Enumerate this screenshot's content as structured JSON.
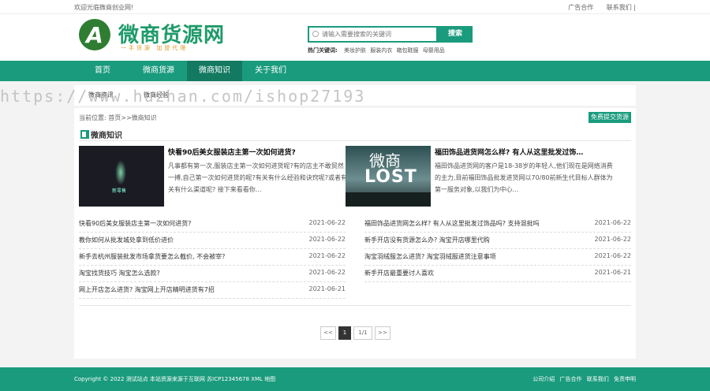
{
  "topbar": {
    "welcome": "欢迎光临微商创业网!",
    "links": [
      "广告合作",
      "联系我们 |"
    ]
  },
  "logo": {
    "letter": "A",
    "title": "微商货源网",
    "slogan": "一手货源 加盟代理"
  },
  "search": {
    "placeholder": "请输入需要搜索的关键词",
    "button": "搜索"
  },
  "hotwords": {
    "label": "热门关键词:",
    "words": [
      "美妆护肤",
      "服装内衣",
      "箱包鞋服",
      "母婴用品"
    ]
  },
  "nav": [
    {
      "label": "首页"
    },
    {
      "label": "微商货源"
    },
    {
      "label": "微商知识"
    },
    {
      "label": "关于我们"
    }
  ],
  "subnav": [
    "微商资讯",
    "微商经验"
  ],
  "watermark": "https://www.huzhan.com/ishop27193",
  "main": {
    "location": "当前位置: 首页>>微商知识",
    "submit_button": "免费提交货源",
    "section_title": "微商知识",
    "features": [
      {
        "title": "快看90后美女服装店主第一次如何进货?",
        "desc": "凡事都有第一次,服装店主第一次如何进货呢?有的店主不敢贸然一搏,自己第一次如何进货的呢?有关有什么经验和诀窍呢?或者有关有什么渠道呢? 接下来看看你…",
        "thumb_text": "新零售"
      },
      {
        "title": "福田饰品进货网怎么样? 有人从这里批发过饰…",
        "desc": "福田饰品进货网的客户是18-38岁的年轻人,他们现在是网络消费的主力,目前福田饰品批发进货网以70/80前新生代目标人群体为第一服务对象,以我们为中心…",
        "thumb_cn": "微商",
        "thumb_en": "LOST"
      }
    ],
    "list_left": [
      {
        "title": "快看90后美女服装店主第一次如何进货?",
        "date": "2021-06-22"
      },
      {
        "title": "教你如何从批发城处拿到低价进价",
        "date": "2021-06-22"
      },
      {
        "title": "新手去杭州服装批发市场拿货要怎么截价, 不会被宰?",
        "date": "2021-06-22"
      },
      {
        "title": "淘宝找货技巧 淘宝怎么选款?",
        "date": "2021-06-22"
      },
      {
        "title": "网上开店怎么进货? 淘宝网上开店精明进货有7招",
        "date": "2021-06-21"
      }
    ],
    "list_right": [
      {
        "title": "福田饰品进货网怎么样? 有人从这里批发过饰品吗? 支持混批吗",
        "date": "2021-06-22"
      },
      {
        "title": "新手开店没有货源怎么办? 淘宝开店哪里代购",
        "date": "2021-06-22"
      },
      {
        "title": "淘宝羽绒服怎么进货? 淘宝羽绒服进货注意事项",
        "date": "2021-06-22"
      },
      {
        "title": "新手开店最重要讨人喜欢",
        "date": "2021-06-21"
      }
    ],
    "pager": {
      "prev": "<<",
      "current": "1",
      "total": "1/1",
      "next": ">>"
    }
  },
  "footer": {
    "copyright": "Copyright © 2022 测试站点 本站资源来源于互联网 苏ICP12345678 XML 地图",
    "links": [
      "公司介绍",
      "广告合作",
      "联系我们",
      "免责申明"
    ]
  },
  "colors": {
    "primary": "#1a9b7d",
    "nav_active": "#137a61"
  }
}
